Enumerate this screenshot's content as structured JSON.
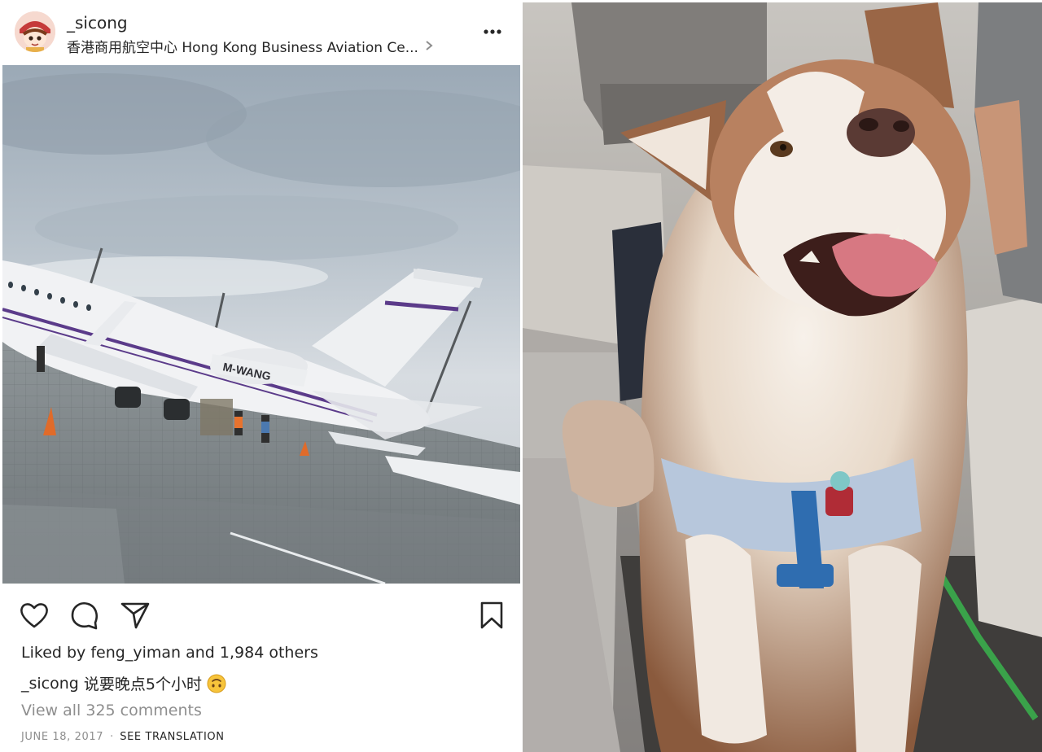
{
  "post": {
    "username": "_sicong",
    "location": "香港商用航空中心 Hong Kong Business Aviation Ce...",
    "photo": {
      "plane_registration": "M-WANG"
    },
    "likes_prefix": "Liked by",
    "liked_by_user": "feng_yiman",
    "likes_connector": "and",
    "likes_count": "1,984 others",
    "caption_user": "_sicong",
    "caption_text": "说要晚点5个小时",
    "caption_emoji": "upside-down-face-emoji",
    "view_comments": "View all 325 comments",
    "date": "JUNE 18, 2017",
    "separator": "·",
    "see_translation": "SEE TRANSLATION"
  },
  "icons": {
    "more": "more-horizontal-icon",
    "like": "heart-icon",
    "comment": "comment-icon",
    "share": "send-icon",
    "save": "bookmark-icon"
  },
  "colors": {
    "text": "#262626",
    "muted": "#8e8e8e",
    "background": "#ffffff"
  }
}
